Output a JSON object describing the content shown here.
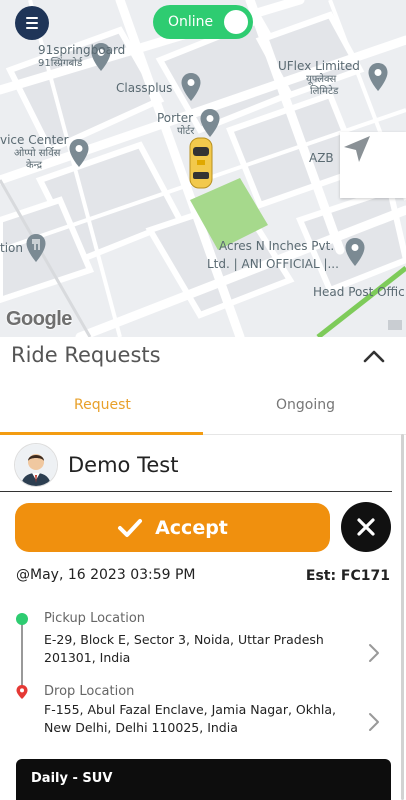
{
  "header": {
    "menu_icon": "hamburger-menu-icon",
    "online_label": "Online",
    "online_on": true,
    "toggle_color": "#2ecc71"
  },
  "map": {
    "labels": {
      "springboard": "91springboard",
      "springboard_hi": "91स्प्रिंगबोर्ड",
      "classplus": "Classplus",
      "uflex": "UFlex Limited",
      "uflex_hi_1": "यूफ्लेक्स",
      "uflex_hi_2": "लिमिटेड",
      "porter": "Porter",
      "porter_hi": "पोर्टर",
      "service_center": "vice Center",
      "service_center_hi_1": "ओप्पो सर्विस",
      "service_center_hi_2": "केन्द्र",
      "azb": "AZB",
      "tion": "tion",
      "acres_1": "Acres N Inches Pvt.",
      "acres_2": "Ltd. | ANI OFFICIAL |...",
      "head_post": "Head Post Offic",
      "google": "Google"
    },
    "locate_icon": "navigation-arrow-icon"
  },
  "panel": {
    "title": "Ride Requests",
    "collapse_icon": "chevron-up-icon",
    "tabs": [
      {
        "label": "Request",
        "active": true
      },
      {
        "label": "Ongoing",
        "active": false
      }
    ],
    "accent_color": "#f39c12"
  },
  "request": {
    "rider_name": "Demo Test",
    "accept_label": "Accept",
    "datetime": "@May, 16 2023 03:59 PM",
    "est_label": "Est:  FC171",
    "pickup_label": "Pickup Location",
    "pickup_address": "E-29, Block E, Sector 3, Noida, Uttar Pradesh 201301, India",
    "drop_label": "Drop Location",
    "drop_address": "F-155, Abul Fazal Enclave, Jamia Nagar, Okhla, New Delhi, Delhi 110025, India",
    "vehicle_label": "Daily - SUV"
  }
}
